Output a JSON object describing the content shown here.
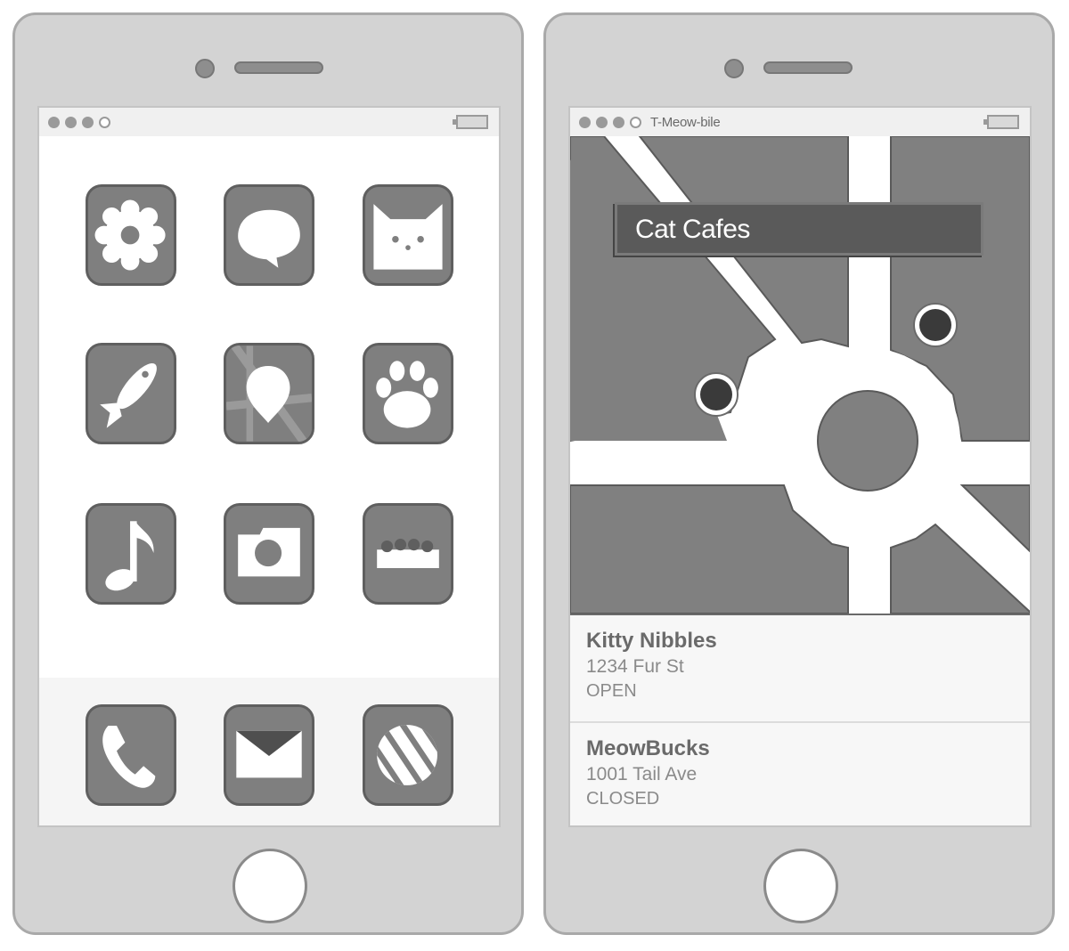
{
  "status_bar_left": {
    "signal_dots": 4,
    "signal_filled": 3
  },
  "status_bar_right": {
    "signal_dots": 4,
    "signal_filled": 3,
    "carrier": "T-Meow-bile"
  },
  "home_screen": {
    "apps": [
      {
        "icon": "gear-icon"
      },
      {
        "icon": "chat-bubble-icon"
      },
      {
        "icon": "cat-face-icon"
      },
      {
        "icon": "fish-icon"
      },
      {
        "icon": "map-pin-icon"
      },
      {
        "icon": "paw-print-icon"
      },
      {
        "icon": "music-note-icon"
      },
      {
        "icon": "camera-icon"
      },
      {
        "icon": "food-bowl-icon"
      }
    ],
    "dock": [
      {
        "icon": "phone-icon"
      },
      {
        "icon": "mail-icon"
      },
      {
        "icon": "ball-icon"
      }
    ]
  },
  "maps_app": {
    "search_query": "Cat Cafes",
    "results": [
      {
        "name": "Kitty Nibbles",
        "address": "1234 Fur St",
        "status": "OPEN"
      },
      {
        "name": "MeowBucks",
        "address": "1001 Tail Ave",
        "status": "CLOSED"
      }
    ]
  },
  "colors": {
    "phone_body": "#d3d3d3",
    "icon_fill": "#7f7f7f",
    "map_block": "#7f7f7f",
    "search_bar": "#5a5a5a",
    "map_marker": "#3a3a3a"
  }
}
